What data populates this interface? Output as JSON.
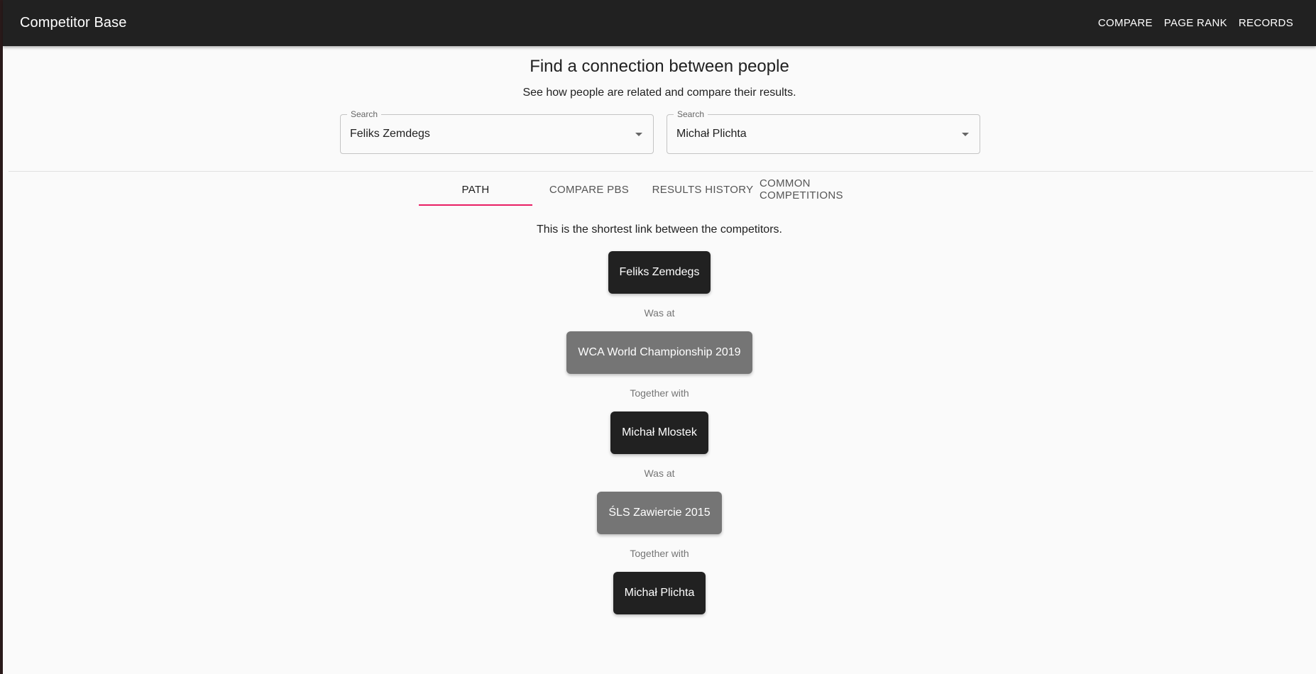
{
  "appbar": {
    "title": "Competitor Base",
    "nav": [
      "COMPARE",
      "PAGE RANK",
      "RECORDS"
    ]
  },
  "header": {
    "title": "Find a connection between people",
    "subtitle": "See how people are related and compare their results."
  },
  "search": [
    {
      "label": "Search",
      "value": "Feliks Zemdegs"
    },
    {
      "label": "Search",
      "value": "Michał Plichta"
    }
  ],
  "tabs": [
    {
      "label": "PATH",
      "active": true
    },
    {
      "label": "COMPARE PBS",
      "active": false
    },
    {
      "label": "RESULTS HISTORY",
      "active": false
    },
    {
      "label": "COMMON COMPETITIONS",
      "active": false
    }
  ],
  "path": {
    "intro": "This is the shortest link between the competitors.",
    "nodes": [
      {
        "type": "person",
        "text": "Feliks Zemdegs"
      },
      {
        "type": "relation",
        "text": "Was at"
      },
      {
        "type": "competition",
        "text": "WCA World Championship 2019"
      },
      {
        "type": "relation",
        "text": "Together with"
      },
      {
        "type": "person",
        "text": "Michał Mlostek"
      },
      {
        "type": "relation",
        "text": "Was at"
      },
      {
        "type": "competition",
        "text": "ŚLS Zawiercie 2015"
      },
      {
        "type": "relation",
        "text": "Together with"
      },
      {
        "type": "person",
        "text": "Michał Plichta"
      }
    ]
  },
  "colors": {
    "appbar": "#212121",
    "tab_indicator": "#e91e63",
    "person_node": "#212121",
    "competition_node": "#757575"
  }
}
